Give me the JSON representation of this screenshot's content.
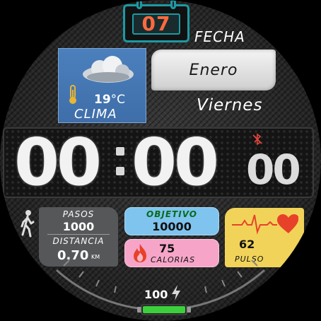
{
  "date": {
    "day": "07",
    "label": "FECHA",
    "month": "Enero",
    "weekday": "Viernes"
  },
  "weather": {
    "temperature": "19",
    "unit": "°C",
    "label": "CLIMA",
    "icon": "cloud-icon"
  },
  "time": {
    "hours": "00",
    "minutes": "00",
    "seconds": "00"
  },
  "steps": {
    "label": "PASOS",
    "value": "1000",
    "distance_label": "DISTANCIA",
    "distance_value": "0.70",
    "distance_unit": "KM"
  },
  "goal": {
    "label": "OBJETIVO",
    "value": "10000"
  },
  "calories": {
    "value": "75",
    "label": "CALORIAS"
  },
  "pulse": {
    "value": "62",
    "label": "PULSO"
  },
  "battery": {
    "value": "100",
    "level": 1.0
  },
  "colors": {
    "calendar_accent": "#1c9aa3",
    "day_number": "#ff6a3d",
    "weather_bg": "#4b80bd",
    "goal_bg": "#7ec4ee",
    "goal_label": "#0b6a1c",
    "calories_bg": "#f6a5c8",
    "pulse_bg": "#f1d35a",
    "heart": "#e8412a",
    "battery": "#3ccf3c",
    "bluetooth_off": "#e0453a"
  }
}
